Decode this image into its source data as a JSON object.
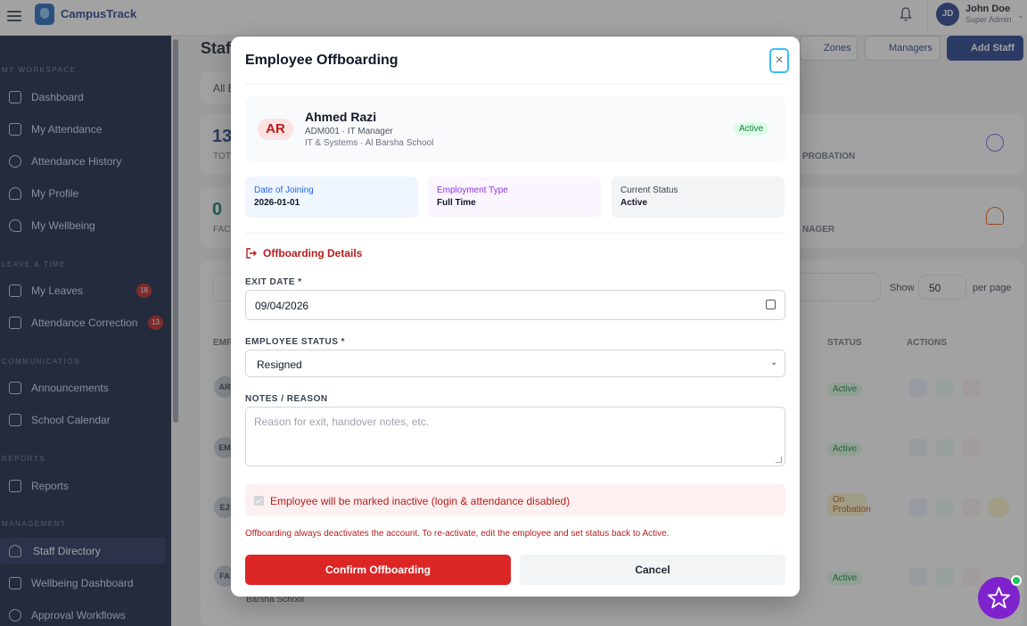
{
  "app": {
    "title": "CampusTrack"
  },
  "user": {
    "initials": "JD",
    "name": "John Doe",
    "role": "Super Admin"
  },
  "sidebar": {
    "sections": {
      "workspace": "MY WORKSPACE",
      "leave": "LEAVE & TIME",
      "communication": "COMMUNICATION",
      "reports": "REPORTS",
      "management": "MANAGEMENT"
    },
    "items": [
      {
        "label": "Dashboard"
      },
      {
        "label": "My Attendance"
      },
      {
        "label": "Attendance History"
      },
      {
        "label": "My Profile"
      },
      {
        "label": "My Wellbeing"
      },
      {
        "label": "My Leaves",
        "badge": "18"
      },
      {
        "label": "Attendance Correction",
        "badge": "13"
      },
      {
        "label": "Announcements"
      },
      {
        "label": "School Calendar"
      },
      {
        "label": "Reports"
      },
      {
        "label": "Staff Directory"
      },
      {
        "label": "Wellbeing Dashboard"
      },
      {
        "label": "Approval Workflows"
      }
    ]
  },
  "background": {
    "title": "Staf",
    "buttons": {
      "zones": "Zones",
      "managers": "Managers",
      "add_staff": "Add Staff"
    },
    "filter_prefix": "All E",
    "stat1": {
      "value": "13",
      "label": "TOT"
    },
    "stat2": {
      "value": "0",
      "label": "FAC"
    },
    "probation_label": "PROBATION",
    "manager_label": "NAGER",
    "show_label": "Show",
    "per_page_value": "50",
    "per_page_label": "per page",
    "col_emp": "EMP",
    "col_status": "STATUS",
    "col_actions": "ACTIONS",
    "rows": [
      {
        "initials": "AR",
        "status": "Active"
      },
      {
        "initials": "EM",
        "status": "Active"
      },
      {
        "initials": "EJ",
        "status": "On Probation"
      },
      {
        "initials": "FA",
        "status": "Active"
      }
    ],
    "footer_text": "Barsha School"
  },
  "modal": {
    "title": "Employee Offboarding",
    "close_label": "×",
    "employee": {
      "initials": "AR",
      "name": "Ahmed Razi",
      "id_role": "ADM001 · IT Manager",
      "dept_school": "IT & Systems · Al Barsha School",
      "status": "Active"
    },
    "info": [
      {
        "key": "Date of Joining",
        "value": "2026-01-01",
        "color": "#2563eb",
        "bg": "#eff6ff"
      },
      {
        "key": "Employment Type",
        "value": "Full Time",
        "color": "#9333ea",
        "bg": "#faf5ff"
      },
      {
        "key": "Current Status",
        "value": "Active",
        "color": "#374151",
        "bg": "#f3f4f6"
      }
    ],
    "section_title": "Offboarding Details",
    "exit_date": {
      "label": "EXIT DATE *",
      "value": "09/04/2026"
    },
    "employee_status": {
      "label": "EMPLOYEE STATUS *",
      "value": "Resigned"
    },
    "notes": {
      "label": "NOTES / REASON",
      "placeholder": "Reason for exit, handover notes, etc."
    },
    "warning": "Employee will be marked inactive (login & attendance disabled)",
    "note": "Offboarding always deactivates the account. To re-activate, edit the employee and set status back to Active.",
    "confirm_label": "Confirm Offboarding",
    "cancel_label": "Cancel"
  },
  "icons": {
    "menu": "menu-icon",
    "bell": "bell-icon",
    "calendar": "calendar-icon",
    "logout": "logout-icon",
    "star": "star-icon",
    "close": "close-icon"
  }
}
